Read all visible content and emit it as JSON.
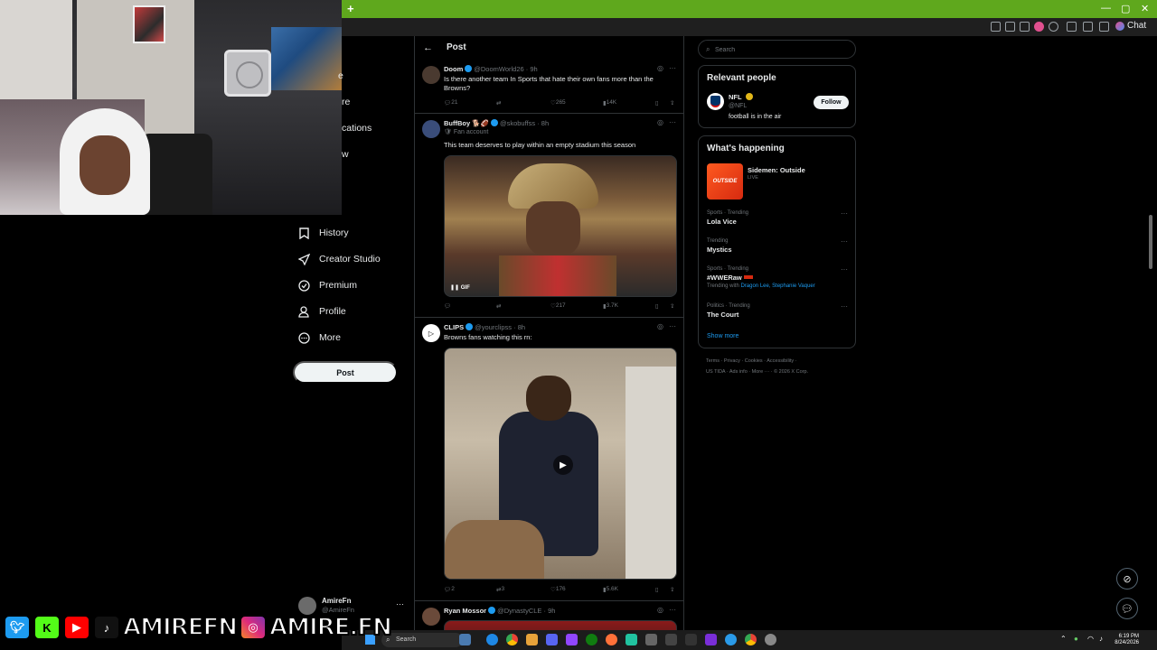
{
  "browser": {
    "new_tab": "+",
    "chat_label": "Chat",
    "window_controls": [
      "—",
      "▢",
      "✕"
    ]
  },
  "nav": {
    "partial_items": [
      "e",
      "re",
      "cations",
      "w"
    ],
    "items": [
      {
        "label": "History",
        "icon": "bookmark-icon"
      },
      {
        "label": "Creator Studio",
        "icon": "rocket-icon"
      },
      {
        "label": "Premium",
        "icon": "verified-icon"
      },
      {
        "label": "Profile",
        "icon": "person-icon"
      },
      {
        "label": "More",
        "icon": "more-circle-icon"
      }
    ],
    "post_button": "Post",
    "account": {
      "name": "AmireFn",
      "handle": "@AmireFn",
      "more": "···"
    }
  },
  "header": {
    "title": "Post",
    "back": "←"
  },
  "tweets": [
    {
      "name": "Doom",
      "handle": "@DoomWorld26",
      "time": "· 9h",
      "text": "Is there another team In Sports that hate their own fans more than the Browns?",
      "stats": {
        "replies": "21",
        "reposts": "",
        "likes": "265",
        "views": "14K"
      }
    },
    {
      "name": "BuffBoy",
      "badge": "🐕🏈",
      "handle": "@skobuffss",
      "time": "· 8h",
      "fan_label": "Fan account",
      "text": "This team deserves to play within an empty stadium this season",
      "media_tag": "GIF",
      "stats": {
        "replies": "",
        "reposts": "",
        "likes": "217",
        "views": "3.7K"
      }
    },
    {
      "name": "CLIPS",
      "handle": "@yourclipss",
      "time": "· 8h",
      "text": "Browns fans watching this rn:",
      "stats": {
        "replies": "2",
        "reposts": "3",
        "likes": "176",
        "views": "5.6K"
      }
    },
    {
      "name": "Ryan Mossor",
      "handle": "@DynastyCLE",
      "time": "· 9h"
    }
  ],
  "right": {
    "search_placeholder": "Search",
    "relevant": {
      "title": "Relevant people",
      "name": "NFL",
      "handle": "@NFL",
      "bio": "football is in the air",
      "follow": "Follow"
    },
    "happening": {
      "title": "What's happening",
      "live": {
        "title": "Sidemen: Outside",
        "status": "LIVE",
        "thumb_text": "OUTSIDE"
      },
      "trends": [
        {
          "category": "Sports · Trending",
          "title": "Lola Vice"
        },
        {
          "category": "Trending",
          "title": "Mystics"
        },
        {
          "category": "Sports · Trending",
          "title": "#WWERaw",
          "with_label": "Trending with",
          "with_links": "Dragon Lee, Stephanie Vaquer"
        },
        {
          "category": "Politics · Trending",
          "title": "The Court"
        }
      ],
      "show_more": "Show more"
    },
    "footer": {
      "line1": "Terms  ·  Privacy  ·  Cookies  ·  Accessibility  ·",
      "line2": "US TIDA  ·  Ads info  ·  More ···  ·  © 2026 X Corp."
    }
  },
  "banner": {
    "handle1": "AMIREFN",
    "handle2": "AMIRE.FN"
  },
  "taskbar": {
    "search": "Search",
    "time": "6:19 PM",
    "date": "8/24/2026"
  },
  "colors": {
    "accent": "#1d9bf0",
    "chrome_green": "#5fa81d",
    "background": "#000000"
  }
}
